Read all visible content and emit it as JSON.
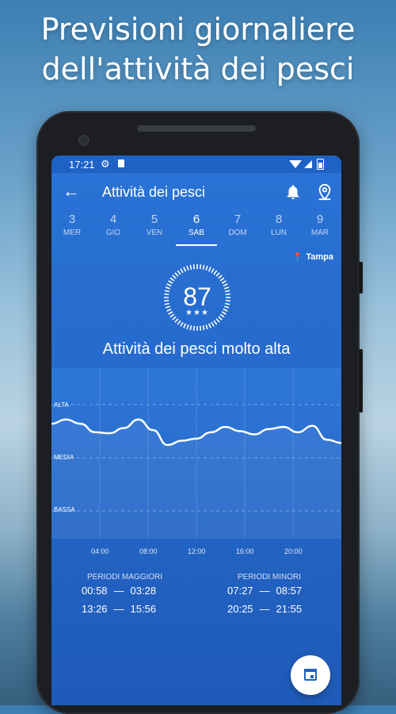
{
  "headline": {
    "line1": "Previsioni giornaliere",
    "line2": "dell'attività dei pesci"
  },
  "statusbar": {
    "time": "17:21",
    "icons": [
      "gear-icon",
      "sd-card-icon",
      "wifi-icon",
      "signal-icon",
      "battery-icon"
    ]
  },
  "toolbar": {
    "title": "Attività dei pesci",
    "back_icon": "arrow-left-icon",
    "bell_icon": "bell-icon",
    "location_icon": "location-pin-icon"
  },
  "days": [
    {
      "num": "3",
      "label": "MER"
    },
    {
      "num": "4",
      "label": "GIO"
    },
    {
      "num": "5",
      "label": "VEN"
    },
    {
      "num": "6",
      "label": "SAB",
      "selected": true
    },
    {
      "num": "7",
      "label": "DOM"
    },
    {
      "num": "8",
      "label": "LUN"
    },
    {
      "num": "9",
      "label": "MAR"
    }
  ],
  "location": "Tampa",
  "score": {
    "value": "87",
    "stars": "★★★",
    "rating_stars": 3
  },
  "activity_text": "Attività dei pesci molto alta",
  "chart_data": {
    "type": "line",
    "ylabels": [
      "ALTA",
      "MEDIA",
      "BASSA"
    ],
    "xlabels": [
      "04:00",
      "08:00",
      "12:00",
      "16:00",
      "20:00"
    ],
    "x": [
      0,
      1.2,
      2.4,
      3.6,
      4.8,
      6,
      7.2,
      8.4,
      9.6,
      10.8,
      12,
      13.2,
      14.4,
      15.6,
      16.8,
      18,
      19.2,
      20.4,
      21.6,
      22.8,
      24
    ],
    "series": [
      {
        "values": [
          0.82,
          0.86,
          0.82,
          0.74,
          0.73,
          0.78,
          0.86,
          0.76,
          0.62,
          0.66,
          0.68,
          0.74,
          0.79,
          0.75,
          0.72,
          0.77,
          0.79,
          0.74,
          0.8,
          0.67,
          0.64
        ]
      }
    ]
  },
  "periods": {
    "major_title": "PERIODI MAGGIORI",
    "minor_title": "PERIODI MINORI",
    "major": [
      {
        "start": "00:58",
        "end": "03:28"
      },
      {
        "start": "13:26",
        "end": "15:56"
      }
    ],
    "minor": [
      {
        "start": "07:27",
        "end": "08:57"
      },
      {
        "start": "20:25",
        "end": "21:55"
      }
    ],
    "dash": "—"
  },
  "fab_icon": "calendar-icon"
}
